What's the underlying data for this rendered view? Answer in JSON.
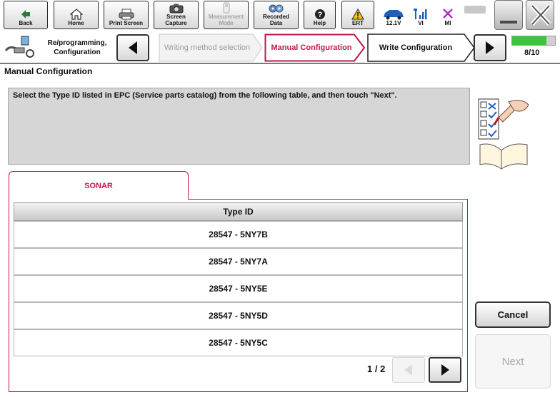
{
  "toolbar": {
    "back": "Back",
    "home": "Home",
    "print_screen": "Print Screen",
    "screen_capture": "Screen Capture",
    "measurement_mode": "Measurement Mode",
    "recorded_data": "Recorded Data",
    "help": "Help",
    "ert": "ERT",
    "voltage": "12.1V",
    "vi": "VI",
    "mi": "MI"
  },
  "nav": {
    "module": "Re/programming, Configuration",
    "step_prev": "Writing method selection",
    "step_current": "Manual Configuration",
    "step_next": "Write Configuration",
    "progress_label": "8/10",
    "progress_fraction": 0.8
  },
  "page": {
    "title": "Manual Configuration",
    "instruction": "Select the Type ID listed in EPC (Service parts catalog) from the following table, and then touch \"Next\"."
  },
  "table": {
    "tab_label": "SONAR",
    "column_header": "Type ID",
    "rows": [
      "28547 - 5NY7B",
      "28547 - 5NY7A",
      "28547 - 5NY5E",
      "28547 - 5NY5D",
      "28547 - 5NY5C"
    ],
    "page_indicator": "1 / 2"
  },
  "actions": {
    "cancel": "Cancel",
    "next": "Next"
  },
  "colors": {
    "accent": "#c0184a",
    "progress_green": "#3cc43c"
  }
}
